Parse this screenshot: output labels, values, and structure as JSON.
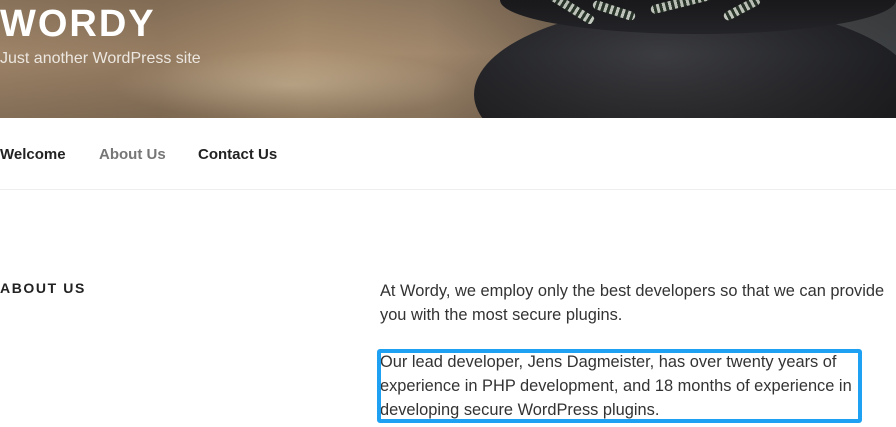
{
  "site": {
    "title": "WORDY",
    "tagline": "Just another WordPress site"
  },
  "nav": {
    "items": [
      {
        "label": "Welcome"
      },
      {
        "label": "About Us"
      },
      {
        "label": "Contact Us"
      }
    ],
    "current": "About Us"
  },
  "page": {
    "heading": "ABOUT US",
    "paragraphs": [
      "At Wordy, we employ only the best developers so that we can provide you with the most secure plugins.",
      "Our lead developer, Jens Dagmeister, has over twenty years of experience in PHP development, and 18 months of experience in developing secure WordPress plugins."
    ]
  },
  "colors": {
    "highlight": "#1ea1f2",
    "current_nav": "#767676",
    "text": "#333333"
  }
}
